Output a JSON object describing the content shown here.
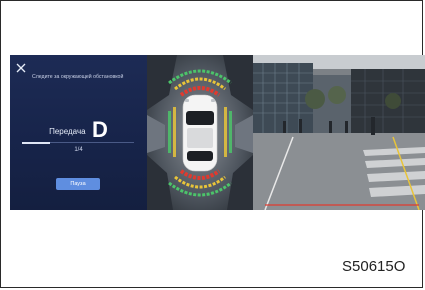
{
  "panel": {
    "hint": "Следите за окружающей обстановкой",
    "gear_label": "Передача",
    "gear_value": "D",
    "page_counter": "1/4",
    "progress": 0.25,
    "pause_label": "Пауза",
    "close_icon": "close-icon"
  },
  "figure_code": "S50615O",
  "colors": {
    "panel_bg": "#1d2b55",
    "button": "#5f8ee0",
    "sensor_red": "#e03a2f",
    "sensor_yellow": "#e8c43a",
    "sensor_green": "#4cc46a"
  }
}
